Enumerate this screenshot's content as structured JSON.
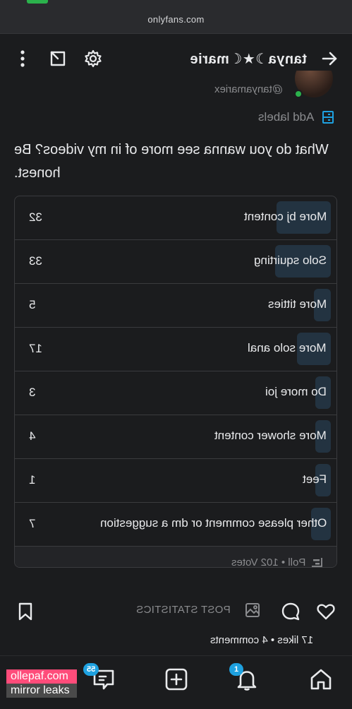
{
  "browser": {
    "url": "onlyfans.com"
  },
  "header": {
    "title": "tanya☽★☾marie"
  },
  "profile": {
    "handle": "@tanyamariex"
  },
  "labels": {
    "add_label": "Add labels"
  },
  "post": {
    "question": "What do you wanna see more of in my videos? Be honest."
  },
  "poll": {
    "options": [
      {
        "label": "More bj content",
        "votes": "32",
        "share": 0.31
      },
      {
        "label": "Solo squirting",
        "votes": "33",
        "share": 0.32
      },
      {
        "label": "More titties",
        "votes": "5",
        "share": 0.05
      },
      {
        "label": "More solo anal",
        "votes": "17",
        "share": 0.17
      },
      {
        "label": "Do more joi",
        "votes": "3",
        "share": 0.03
      },
      {
        "label": "More shower content",
        "votes": "4",
        "share": 0.04
      },
      {
        "label": "Feet",
        "votes": "1",
        "share": 0.01
      },
      {
        "label": "Other please comment or dm a suggestion",
        "votes": "7",
        "share": 0.07
      }
    ],
    "footer": "Poll • 102 Votes"
  },
  "actions": {
    "stats": "POST STATISTICS"
  },
  "engagement": {
    "summary": "17 likes • 4 comments"
  },
  "nav": {
    "notifications_badge": "1",
    "messages_badge": "55"
  },
  "watermark": {
    "line1": "ollepaf.com",
    "line2": "mirror leaks"
  },
  "colors": {
    "accent": "#1ea1e0",
    "poll_fill": "#233341",
    "background": "#1b1c1e"
  }
}
